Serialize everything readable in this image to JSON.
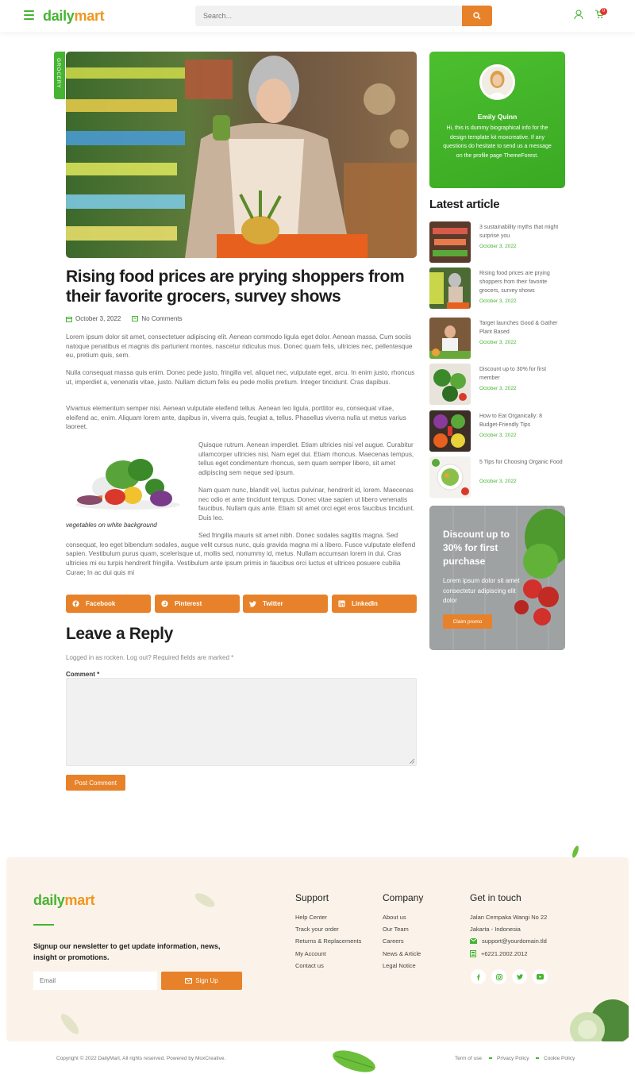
{
  "header": {
    "logo_part1": "daily",
    "logo_part2": "mart",
    "search_placeholder": "Search...",
    "cart_count": "0"
  },
  "article": {
    "category": "GROCERY",
    "title": "Rising food prices are prying shoppers from their favorite grocers, survey shows",
    "date": "October 3, 2022",
    "comments": "No Comments",
    "paragraphs": [
      "Lorem ipsum dolor sit amet, consectetuer adipiscing elit. Aenean commodo ligula eget dolor. Aenean massa. Cum sociis natoque penatibus et magnis dis parturient montes, nascetur ridiculus mus. Donec quam felis, ultricies nec, pellentesque eu, pretium quis, sem.",
      "Nulla consequat massa quis enim. Donec pede justo, fringilla vel, aliquet nec, vulputate eget, arcu. In enim justo, rhoncus ut, imperdiet a, venenatis vitae, justo. Nullam dictum felis eu pede mollis pretium. Integer tincidunt. Cras dapibus.",
      "Vivamus elementum semper nisi. Aenean vulputate eleifend tellus. Aenean leo ligula, porttitor eu, consequat vitae, eleifend ac, enim. Aliquam lorem ante, dapibus in, viverra quis, feugiat a, tellus. Phasellus viverra nulla ut metus varius laoreet.",
      "Quisque rutrum. Aenean imperdiet. Etiam ultricies nisi vel augue. Curabitur ullamcorper ultricies nisi. Nam eget dui. Etiam rhoncus. Maecenas tempus, tellus eget condimentum rhoncus, sem quam semper libero, sit amet adipiscing sem neque sed ipsum.",
      "Nam quam nunc, blandit vel, luctus pulvinar, hendrerit id, lorem. Maecenas nec odio et ante tincidunt tempus. Donec vitae sapien ut libero venenatis faucibus. Nullam quis ante. Etiam sit amet orci eget eros faucibus tincidunt. Duis leo.",
      "Sed fringilla mauris sit amet nibh. Donec sodales sagittis magna. Sed consequat, leo eget bibendum sodales, augue velit cursus nunc, quis gravida magna mi a libero. Fusce vulputate eleifend sapien. Vestibulum purus quam, scelerisque ut, mollis sed, nonummy id, metus. Nullam accumsan lorem in dui. Cras ultricies mi eu turpis hendrerit fringilla. Vestibulum ante ipsum primis in faucibus orci luctus et ultrices posuere cubilia Curae; In ac dui quis mi"
    ],
    "image_caption": "vegetables on white background",
    "share": {
      "facebook": "Facebook",
      "pinterest": "Pinterest",
      "twitter": "Twitter",
      "linkedin": "LinkedIn"
    }
  },
  "reply": {
    "heading": "Leave a Reply",
    "logged_in": "Logged in as rocken. Log out? Required fields are marked *",
    "comment_label": "Comment *",
    "submit": "Post Comment"
  },
  "sidebar": {
    "profile_name": "Emily Quinn",
    "profile_bio": "Hi, this is dummy biographical info for the design template kit moxcreative. If any questions do hesitate to send us a message on the profile page ThemeForest.",
    "latest_heading": "Latest article",
    "articles": [
      {
        "title": "3 sustainability myths that might surprise you",
        "date": "October 3, 2022"
      },
      {
        "title": "Rising food prices are prying shoppers from their favorite grocers, survey shows",
        "date": "October 3, 2022"
      },
      {
        "title": "Target launches Good & Gather Plant Based",
        "date": "October 3, 2022"
      },
      {
        "title": "Discount up to 30% for first member",
        "date": "October 3, 2022"
      },
      {
        "title": "How to Eat Organically: 8 Budget-Friendly Tips",
        "date": "October 3, 2022"
      },
      {
        "title": "5 Tips for Choosing Organic Food",
        "date": "October 3, 2022"
      }
    ],
    "promo": {
      "title": "Discount up to 30% for first purchase",
      "text": "Lorem ipsum dolor sit amet consectetur adipiscing elit dolor",
      "button": "Claim promo"
    }
  },
  "footer": {
    "newsletter": "Signup our newsletter to get update information, news, insight or promotions.",
    "email_placeholder": "Email",
    "signup": "Sign Up",
    "support_heading": "Support",
    "support_links": [
      "Help Center",
      "Track your order",
      "Returns & Replacements",
      "My Account",
      "Contact us"
    ],
    "company_heading": "Company",
    "company_links": [
      "About us",
      "Our Team",
      "Careers",
      "News & Article",
      "Legal Notice"
    ],
    "contact_heading": "Get in touch",
    "address1": "Jalan Cempaka Wangi No 22",
    "address2": "Jakarta - Indonesia",
    "email": "support@yourdomain.tld",
    "phone": "+6221.2002.2012",
    "copyright": "Copyright © 2022 DailyMart, All rights reserved. Powered by MoxCreative.",
    "legal_links": [
      "Term of use",
      "Privacy Policy",
      "Cookie Policy"
    ]
  },
  "colors": {
    "brand_green": "#46b432",
    "brand_orange": "#e7822a",
    "footer_bg": "#fbf3e9"
  }
}
